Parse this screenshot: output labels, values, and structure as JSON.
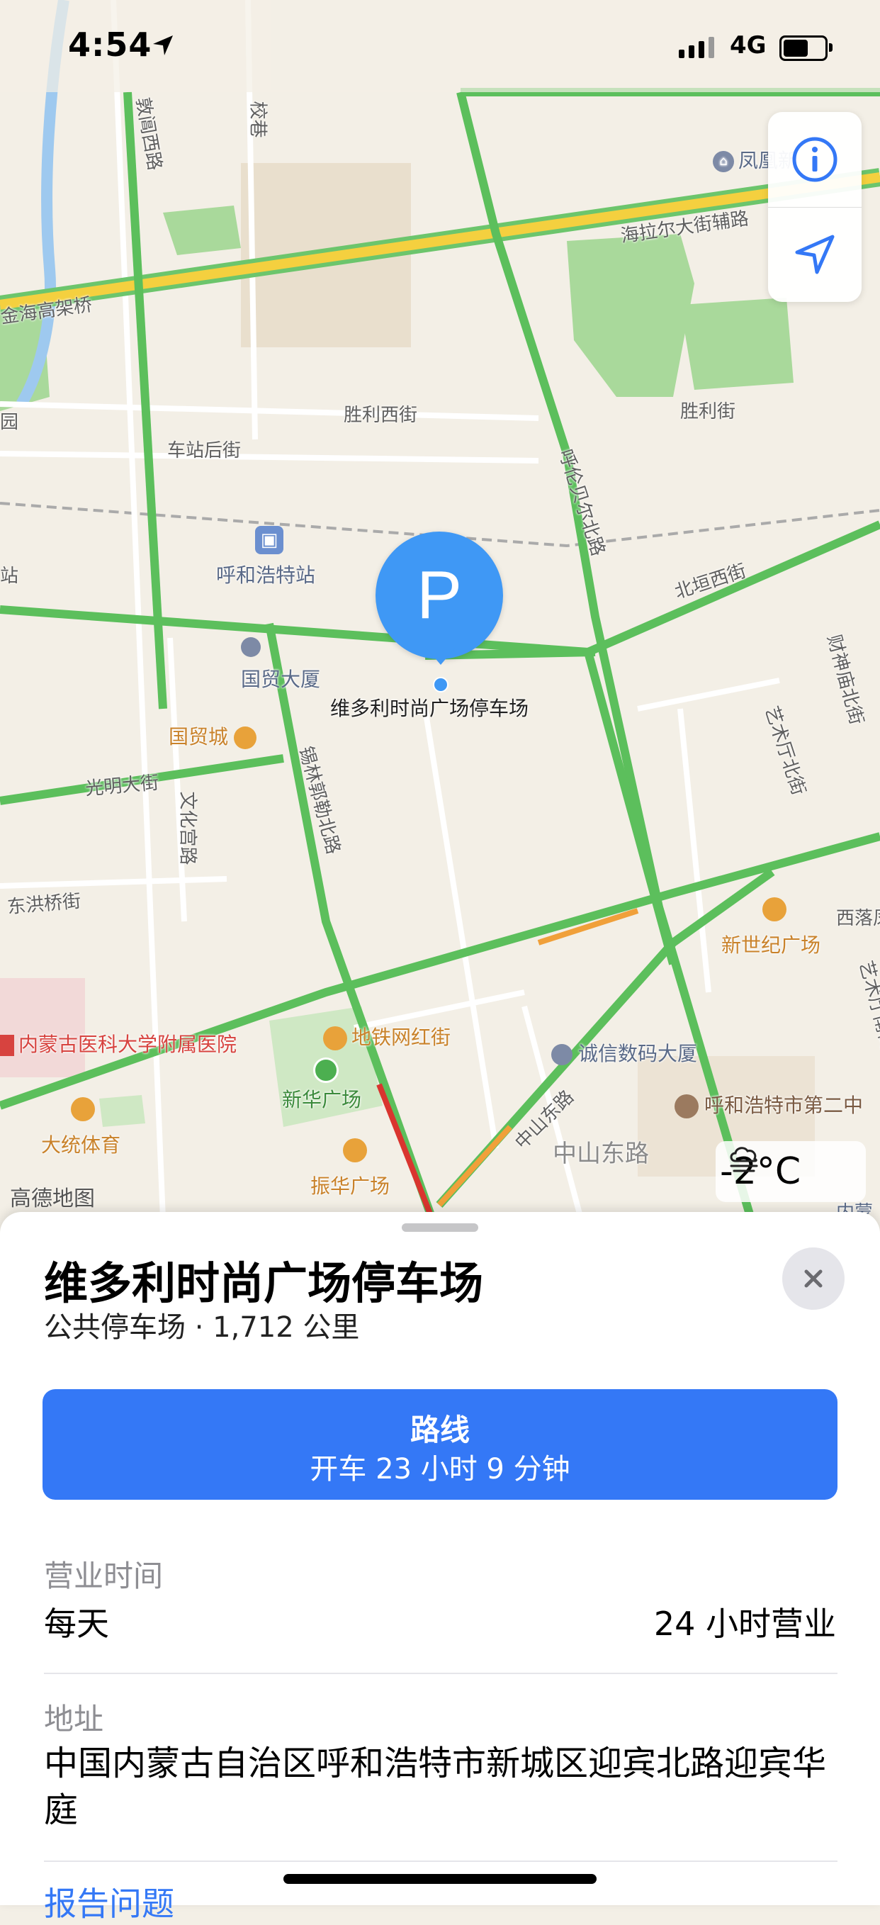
{
  "status_bar": {
    "time": "4:54",
    "network": "4G"
  },
  "map": {
    "road_labels": {
      "heyou_west_road": "敦阊西路",
      "xiang": "校巷",
      "jinhai_overpass": "金海高架桥",
      "hailaer_aux": "海拉尔大街辅路",
      "shengli_west": "胜利西街",
      "shengli": "胜利街",
      "chezhan_hou": "车站后街",
      "hulunbeier_north": "呼伦贝尔北路",
      "beiheng_west": "北垣西街",
      "caishen_miao_north": "财神庙北街",
      "yishuting_north": "艺术厅北街",
      "guangming": "光明大街",
      "wenhua_gong": "文化宫路",
      "xilinguole_north": "锡林郭勒北路",
      "donghongqiao": "东洪桥街",
      "zhongshan_east_small": "中山东路",
      "zhongshan_east_big": "中山东路",
      "xiluo": "西落凤街",
      "yishuting_south": "艺术厅南街",
      "yuan": "园",
      "zhan": "站"
    },
    "poi_labels": {
      "fenghuang": "凤凰新",
      "station": "呼和浩特站",
      "guomao_building": "国贸大厦",
      "guomao_city": "国贸城",
      "parking": "维多利时尚广场停车场",
      "new_century": "新世纪广场",
      "metro_street": "地铁网红街",
      "xinhua_square": "新华广场",
      "chengxin": "诚信数码大厦",
      "hospital": "内蒙古医科大学附属医院",
      "school_2": "呼和浩特市第二中",
      "datong": "大统体育",
      "zhenhua": "振华广场",
      "neimeng": "内蒙"
    },
    "pin_letter": "P",
    "weather_temp": "-2°C",
    "attribution": "高德地图"
  },
  "place": {
    "title": "维多利时尚广场停车场",
    "subtitle": "公共停车场 · 1,712 公里",
    "route_label": "路线",
    "route_time": "开车 23 小时 9 分钟",
    "hours_label": "营业时间",
    "hours_day": "每天",
    "hours_value": "24 小时营业",
    "address_label": "地址",
    "address": "中国内蒙古自治区呼和浩特市新城区迎宾北路迎宾华庭",
    "report_label": "报告问题"
  },
  "colors": {
    "accent": "#3478f6",
    "pin": "#3f98f5",
    "road_green": "#5cbf5c",
    "road_yellow": "#f4d03f"
  }
}
